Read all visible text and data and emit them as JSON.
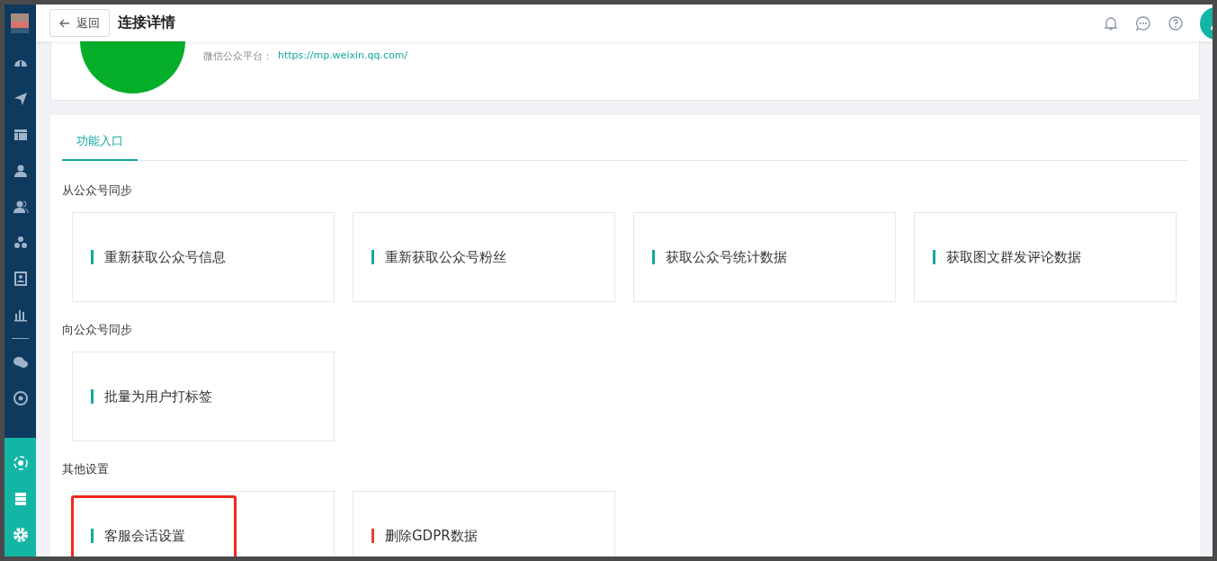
{
  "header": {
    "back_button": "返回",
    "title": "连接详情"
  },
  "platform": {
    "label": "微信公众平台：",
    "url": "https://mp.weixin.qq.com/"
  },
  "tabs": [
    {
      "label": "功能入口",
      "selected": true
    }
  ],
  "sections": [
    {
      "title": "从公众号同步",
      "tiles": [
        {
          "label": "重新获取公众号信息",
          "color": "#13a89e"
        },
        {
          "label": "重新获取公众号粉丝",
          "color": "#13a89e"
        },
        {
          "label": "获取公众号统计数据",
          "color": "#13a89e"
        },
        {
          "label": "获取图文群发评论数据",
          "color": "#13a89e"
        }
      ]
    },
    {
      "title": "向公众号同步",
      "tiles": [
        {
          "label": "批量为用户打标签",
          "color": "#13a89e"
        }
      ]
    },
    {
      "title": "其他设置",
      "tiles": [
        {
          "label": "客服会话设置",
          "color": "#13a89e"
        },
        {
          "label": "删除GDPR数据",
          "color": "#e0452c"
        }
      ]
    }
  ]
}
